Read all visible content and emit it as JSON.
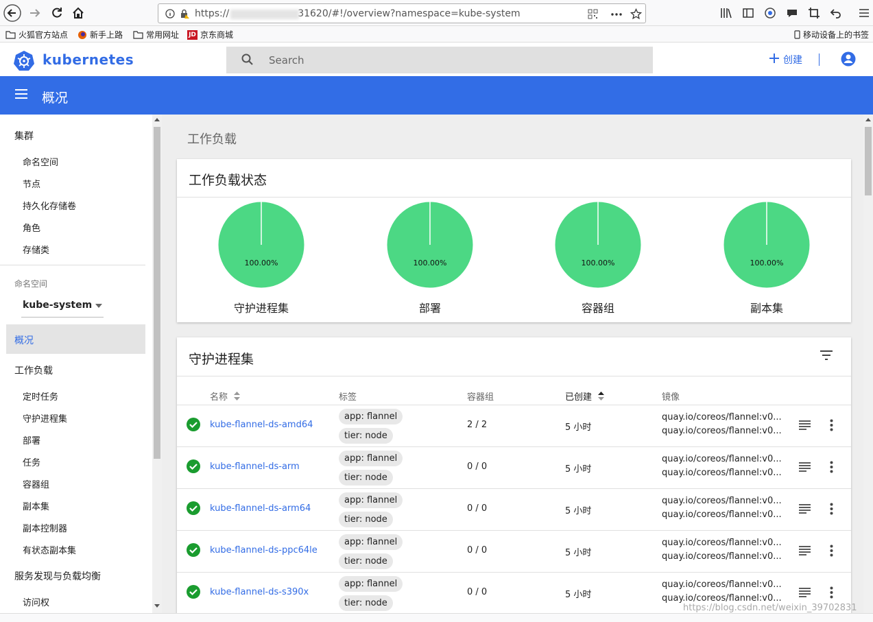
{
  "browser": {
    "url_prefix": "https://",
    "url_suffix": "31620/#!/overview?namespace=kube-system",
    "bookmarks": [
      {
        "label": "火狐官方站点",
        "icon": "folder-icon"
      },
      {
        "label": "新手上路",
        "icon": "firefox-icon"
      },
      {
        "label": "常用网址",
        "icon": "folder-icon"
      },
      {
        "label": "京东商城",
        "icon": "jd-icon"
      }
    ],
    "mobile_bookmarks": "移动设备上的书签"
  },
  "header": {
    "logo_text": "kubernetes",
    "search_placeholder": "Search",
    "create_label": "创建"
  },
  "toolbar": {
    "title": "概况"
  },
  "sidebar": {
    "cluster_heading": "集群",
    "cluster_items": [
      "命名空间",
      "节点",
      "持久化存储卷",
      "角色",
      "存储类"
    ],
    "namespace_label": "命名空间",
    "namespace_value": "kube-system",
    "overview": "概况",
    "workloads_heading": "工作负载",
    "workload_items": [
      "定时任务",
      "守护进程集",
      "部署",
      "任务",
      "容器组",
      "副本集",
      "副本控制器",
      "有状态副本集"
    ],
    "discovery_heading": "服务发现与负载均衡",
    "discovery_items": [
      "访问权"
    ]
  },
  "main": {
    "section_title": "工作负载",
    "status_card": {
      "title": "工作负载状态",
      "charts": [
        {
          "label": "守护进程集",
          "percent": "100.00%"
        },
        {
          "label": "部署",
          "percent": "100.00%"
        },
        {
          "label": "容器组",
          "percent": "100.00%"
        },
        {
          "label": "副本集",
          "percent": "100.00%"
        }
      ]
    },
    "daemonset_card": {
      "title": "守护进程集",
      "columns": {
        "name": "名称",
        "labels": "标签",
        "pods": "容器组",
        "created": "已创建",
        "images": "镜像"
      },
      "rows": [
        {
          "name": "kube-flannel-ds-amd64",
          "label1": "app: flannel",
          "label2": "tier: node",
          "pods": "2 / 2",
          "created": "5 小时",
          "image1": "quay.io/coreos/flannel:v0...",
          "image2": "quay.io/coreos/flannel:v0..."
        },
        {
          "name": "kube-flannel-ds-arm",
          "label1": "app: flannel",
          "label2": "tier: node",
          "pods": "0 / 0",
          "created": "5 小时",
          "image1": "quay.io/coreos/flannel:v0...",
          "image2": "quay.io/coreos/flannel:v0..."
        },
        {
          "name": "kube-flannel-ds-arm64",
          "label1": "app: flannel",
          "label2": "tier: node",
          "pods": "0 / 0",
          "created": "5 小时",
          "image1": "quay.io/coreos/flannel:v0...",
          "image2": "quay.io/coreos/flannel:v0..."
        },
        {
          "name": "kube-flannel-ds-ppc64le",
          "label1": "app: flannel",
          "label2": "tier: node",
          "pods": "0 / 0",
          "created": "5 小时",
          "image1": "quay.io/coreos/flannel:v0...",
          "image2": "quay.io/coreos/flannel:v0..."
        },
        {
          "name": "kube-flannel-ds-s390x",
          "label1": "app: flannel",
          "label2": "tier: node",
          "pods": "0 / 0",
          "created": "5 小时",
          "image1": "quay.io/coreos/flannel:v0...",
          "image2": "quay.io/coreos/flannel:v0..."
        }
      ]
    }
  },
  "watermark": "https://blog.csdn.net/weixin_39702831",
  "colors": {
    "brand": "#326ce5",
    "success": "#1a9c2f",
    "pie": "#4cd884"
  }
}
